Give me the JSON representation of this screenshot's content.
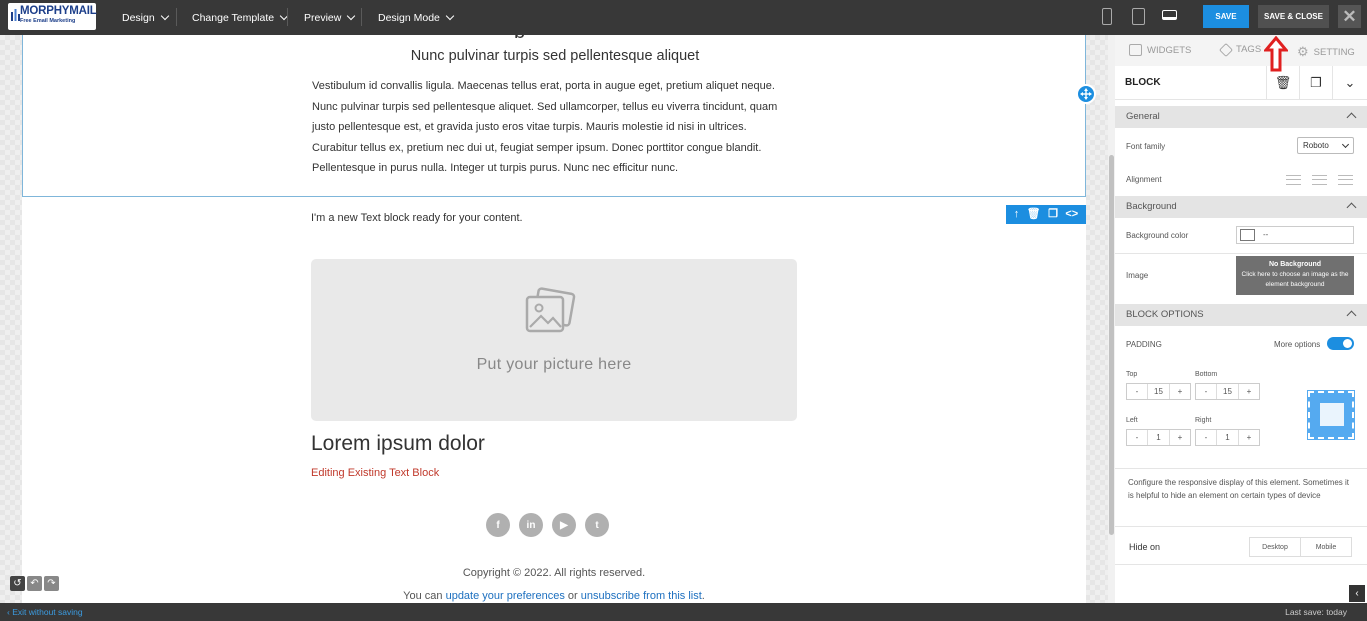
{
  "topbar": {
    "logo_title": "MORPHYMAIL",
    "logo_subtitle": "Free Email Marketing",
    "menus": [
      "Design",
      "Change Template",
      "Preview",
      "Design Mode"
    ],
    "devices": [
      "mobile-icon",
      "tablet-icon",
      "desktop-icon"
    ],
    "save_label": "SAVE",
    "save_close_label": "SAVE & CLOSE",
    "close_glyph": "✕"
  },
  "email": {
    "subheading": "Nunc pulvinar turpis sed pellentesque aliquet",
    "paragraph_lines": [
      "Vestibulum id convallis ligula. Maecenas tellus erat, porta in augue eget, pretium aliquet neque.",
      "Nunc pulvinar turpis sed pellentesque aliquet. Sed ullamcorper, tellus eu viverra tincidunt, quam",
      "justo pellentesque est, et gravida justo eros vitae turpis. Mauris molestie id nisi in ultrices.",
      "Curabitur tellus ex, pretium nec dui ut, feugiat semper ipsum. Donec porttitor congue blandit.",
      "Pellentesque in purus nulla. Integer ut turpis purus. Nunc nec efficitur nunc."
    ],
    "new_text_block": "I'm a new Text block ready for your content.",
    "picture_placeholder": "Put your picture here",
    "heading": "Lorem ipsum dolor",
    "editing_text": "Editing Existing Text Block",
    "social_icons": [
      "facebook-icon",
      "linkedin-icon",
      "youtube-icon",
      "twitter-icon"
    ],
    "copyright": "Copyright © 2022. All rights reserved.",
    "prefs_prefix": "You can ",
    "prefs_link": "update your preferences",
    "prefs_mid": " or ",
    "unsub_link": "unsubscribe from this list",
    "prefs_suffix": "."
  },
  "panel": {
    "tabs": [
      "WIDGETS",
      "TAGS",
      "SETTING"
    ],
    "block_title": "BLOCK",
    "general": {
      "header": "General",
      "font_family_label": "Font family",
      "font_family_value": "Roboto",
      "alignment_label": "Alignment"
    },
    "background": {
      "header": "Background",
      "color_label": "Background color",
      "color_value": "--",
      "image_label": "Image",
      "no_bg_title": "No Background",
      "no_bg_hint": "Click here to choose an image as the element background"
    },
    "block_options": {
      "header": "BLOCK OPTIONS",
      "padding_label": "PADDING",
      "more_options_label": "More options",
      "more_options_on": true,
      "top_label": "Top",
      "top_value": "15",
      "bottom_label": "Bottom",
      "bottom_value": "15",
      "left_label": "Left",
      "left_value": "1",
      "right_label": "Right",
      "right_value": "1",
      "minus": "-",
      "plus": "+"
    },
    "responsive_text": "Configure the responsive display of this element. Sometimes it is helpful to hide an element on certain types of device",
    "hide_on_label": "Hide on",
    "hide_on_options": [
      "Desktop",
      "Mobile"
    ]
  },
  "bottombar": {
    "exit_label": "Exit without saving",
    "last_save": "Last save: today"
  },
  "colors": {
    "accent": "#1c8ee0",
    "topbar": "#383838",
    "editing_text": "#c0392b",
    "arrow": "#e02020"
  }
}
